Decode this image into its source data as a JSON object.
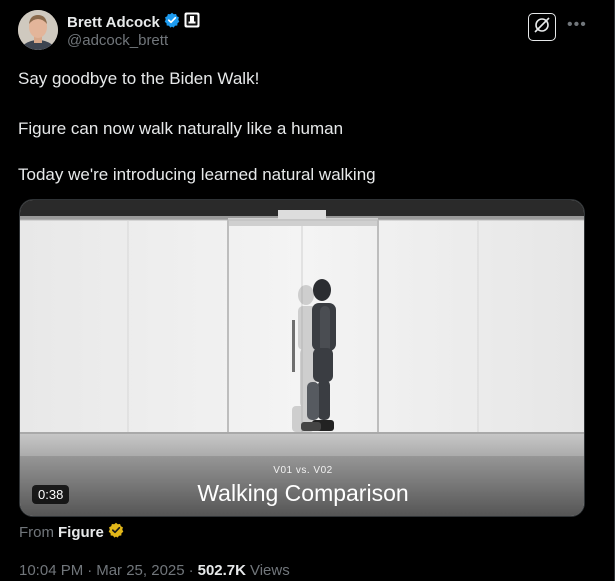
{
  "author": {
    "name": "Brett Adcock",
    "handle": "@adcock_brett"
  },
  "post": {
    "lines": [
      "Say goodbye to the Biden Walk!",
      "Figure can now walk naturally like a human",
      "Today we're introducing learned natural walking"
    ]
  },
  "video": {
    "duration": "0:38",
    "subtitle": "V01 vs. V02",
    "title": "Walking Comparison"
  },
  "source": {
    "from_label": "From",
    "name": "Figure"
  },
  "meta": {
    "time": "10:04 PM",
    "separator": "·",
    "date": "Mar 25, 2025",
    "views_count": "502.7K",
    "views_label": "Views"
  },
  "colors": {
    "background": "#000000",
    "text": "#e7e9ea",
    "secondary": "#71767b",
    "verified_blue": "#1d9bf0",
    "affiliate_gold": "#e2b719"
  },
  "icons": {
    "verified": "verified-badge-icon",
    "affiliate": "affiliate-badge-icon",
    "grok": "grok-icon",
    "more": "more-icon",
    "figure_badge": "gold-verified-badge-icon"
  }
}
